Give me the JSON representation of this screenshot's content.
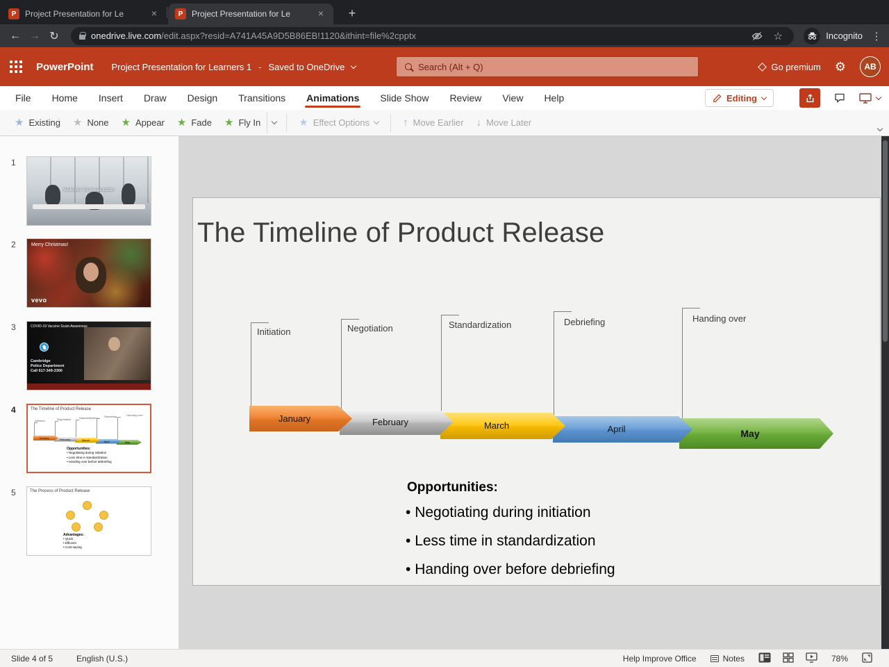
{
  "colors": {
    "brand_red": "#bd3c1e",
    "accent_red": "#c43e1c",
    "selected_thumb_border": "#d4593a",
    "arrow_january": "#ed7d31",
    "arrow_february": "#bfbfbf",
    "arrow_march": "#ffc000",
    "arrow_april": "#5b9bd5",
    "arrow_may": "#70ad47"
  },
  "browser": {
    "tabs": [
      {
        "title": "Project Presentation for Le"
      },
      {
        "title": "Project Presentation for Le"
      }
    ],
    "url_host": "onedrive.live.com",
    "url_path": "/edit.aspx?resid=A741A45A9D5B86EB!1120&ithint=file%2cpptx",
    "incognito_label": "Incognito"
  },
  "app_header": {
    "app_name": "PowerPoint",
    "doc_title": "Project Presentation for Learners 1",
    "separator": "-",
    "save_status": "Saved to OneDrive",
    "search_placeholder": "Search (Alt + Q)",
    "go_premium_label": "Go premium",
    "avatar_initials": "AB"
  },
  "menu_bar": {
    "items": [
      "File",
      "Home",
      "Insert",
      "Draw",
      "Design",
      "Transitions",
      "Animations",
      "Slide Show",
      "Review",
      "View",
      "Help"
    ],
    "active_item": "Animations",
    "editing_label": "Editing"
  },
  "ribbon": {
    "effects": [
      {
        "label": "Existing"
      },
      {
        "label": "None"
      },
      {
        "label": "Appear"
      },
      {
        "label": "Fade"
      },
      {
        "label": "Fly In"
      }
    ],
    "effect_options_label": "Effect Options",
    "move_earlier_label": "Move Earlier",
    "move_later_label": "Move Later"
  },
  "slides_panel": {
    "selected_slide": 4,
    "slides": [
      {
        "number": "1",
        "caption": "Welcome To Presentation"
      },
      {
        "number": "2",
        "caption": "Merry Christmas!",
        "logo": "vevo"
      },
      {
        "number": "3",
        "caption": "COVID-19 Vaccine Scam Awareness",
        "info_line1": "Cambridge",
        "info_line2": "Police Department",
        "info_line3": "Call 617-349-3300"
      },
      {
        "number": "4",
        "caption": "The Timeline of Product Release"
      },
      {
        "number": "5",
        "caption": "The Process of Product Release",
        "adv_heading": "Advantages:",
        "advantages": [
          "Quick",
          "Efficient",
          "Cost-saving"
        ]
      }
    ]
  },
  "slide": {
    "title": "The Timeline of Product Release",
    "milestones": [
      {
        "phase": "Initiation",
        "month": "January"
      },
      {
        "phase": "Negotiation",
        "month": "February"
      },
      {
        "phase": "Standardization",
        "month": "March"
      },
      {
        "phase": "Debriefing",
        "month": "April"
      },
      {
        "phase": "Handing over",
        "month": "May"
      }
    ],
    "opportunities_heading": "Opportunities:",
    "opportunities": [
      "Negotiating during initiation",
      "Less time in standardization",
      "Handing over before debriefing"
    ]
  },
  "status_bar": {
    "slide_position": "Slide 4 of 5",
    "language": "English (U.S.)",
    "help_improve_label": "Help Improve Office",
    "notes_label": "Notes",
    "zoom_level": "78%"
  }
}
